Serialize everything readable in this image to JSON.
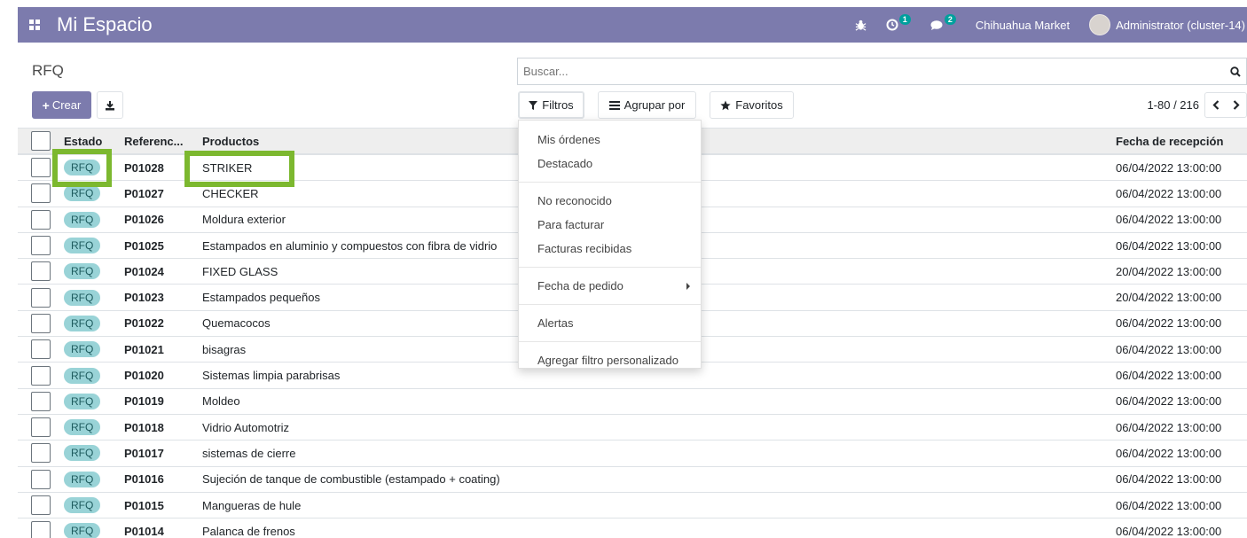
{
  "navbar": {
    "brand": "Mi Espacio",
    "activity_count": "1",
    "messages_count": "2",
    "company": "Chihuahua Market",
    "user": "Administrator (cluster-14)"
  },
  "breadcrumb": "RFQ",
  "search": {
    "placeholder": "Buscar..."
  },
  "buttons": {
    "create": "Crear",
    "filters": "Filtros",
    "group_by": "Agrupar por",
    "favorites": "Favoritos"
  },
  "pager": {
    "value": "1-80 / 216"
  },
  "table": {
    "headers": {
      "estado": "Estado",
      "referencia": "Referenc...",
      "productos": "Productos",
      "fecha": "Fecha de recepción"
    },
    "rows": [
      {
        "estado": "RFQ",
        "ref": "P01028",
        "prod": "STRIKER",
        "fecha": "06/04/2022 13:00:00"
      },
      {
        "estado": "RFQ",
        "ref": "P01027",
        "prod": "CHECKER",
        "fecha": "06/04/2022 13:00:00"
      },
      {
        "estado": "RFQ",
        "ref": "P01026",
        "prod": "Moldura exterior",
        "fecha": "06/04/2022 13:00:00"
      },
      {
        "estado": "RFQ",
        "ref": "P01025",
        "prod": "Estampados en aluminio y compuestos con fibra de vidrio",
        "fecha": "06/04/2022 13:00:00"
      },
      {
        "estado": "RFQ",
        "ref": "P01024",
        "prod": "FIXED GLASS",
        "fecha": "20/04/2022 13:00:00"
      },
      {
        "estado": "RFQ",
        "ref": "P01023",
        "prod": "Estampados pequeños",
        "fecha": "20/04/2022 13:00:00"
      },
      {
        "estado": "RFQ",
        "ref": "P01022",
        "prod": "Quemacocos",
        "fecha": "06/04/2022 13:00:00"
      },
      {
        "estado": "RFQ",
        "ref": "P01021",
        "prod": "bisagras",
        "fecha": "06/04/2022 13:00:00"
      },
      {
        "estado": "RFQ",
        "ref": "P01020",
        "prod": "Sistemas limpia parabrisas",
        "fecha": "06/04/2022 13:00:00"
      },
      {
        "estado": "RFQ",
        "ref": "P01019",
        "prod": "Moldeo",
        "fecha": "06/04/2022 13:00:00"
      },
      {
        "estado": "RFQ",
        "ref": "P01018",
        "prod": "Vidrio Automotriz",
        "fecha": "06/04/2022 13:00:00"
      },
      {
        "estado": "RFQ",
        "ref": "P01017",
        "prod": "sistemas de cierre",
        "fecha": "06/04/2022 13:00:00"
      },
      {
        "estado": "RFQ",
        "ref": "P01016",
        "prod": "Sujeción de tanque de combustible (estampado + coating)",
        "fecha": "06/04/2022 13:00:00"
      },
      {
        "estado": "RFQ",
        "ref": "P01015",
        "prod": "Mangueras de hule",
        "fecha": "06/04/2022 13:00:00"
      },
      {
        "estado": "RFQ",
        "ref": "P01014",
        "prod": "Palanca de frenos",
        "fecha": "06/04/2022 13:00:00"
      }
    ]
  },
  "filters_menu": {
    "mis_ordenes": "Mis órdenes",
    "destacado": "Destacado",
    "no_reconocido": "No reconocido",
    "para_facturar": "Para facturar",
    "facturas_recibidas": "Facturas recibidas",
    "fecha_pedido": "Fecha de pedido",
    "alertas": "Alertas",
    "agregar": "Agregar filtro personalizado"
  },
  "colors": {
    "navbar": "#7c7bad",
    "badge": "#99d3d7",
    "highlight": "#7cb82f"
  },
  "icons": [
    "apps-icon",
    "bug-icon",
    "activity-icon",
    "messages-icon",
    "search-icon",
    "download-icon",
    "filter-icon",
    "group-icon",
    "star-icon",
    "chevron-left-icon",
    "chevron-right-icon",
    "caret-right-icon"
  ]
}
